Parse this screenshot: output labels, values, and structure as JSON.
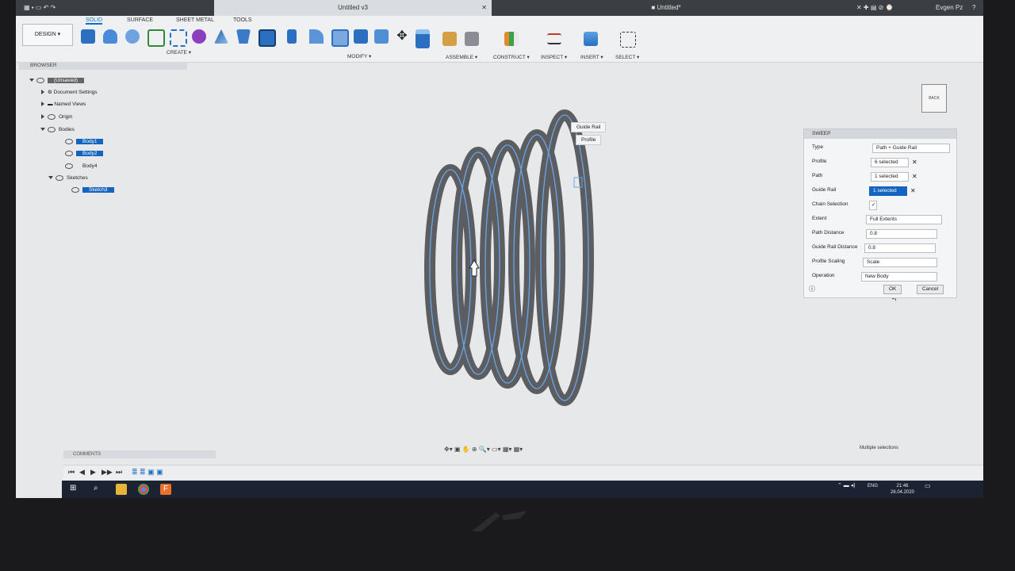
{
  "window": {
    "tab_left": "Untitled v3",
    "tab_right": "Untitled*",
    "user": "Evgen Pz"
  },
  "ribbon": {
    "tabs": [
      "SOLID",
      "SURFACE",
      "SHEET METAL",
      "TOOLS"
    ],
    "design_label": "DESIGN ▾",
    "groups": [
      "CREATE ▾",
      "MODIFY ▾",
      "ASSEMBLE ▾",
      "CONSTRUCT ▾",
      "INSPECT ▾",
      "INSERT ▾",
      "SELECT ▾"
    ]
  },
  "browser": {
    "title": "BROWSER",
    "root": "(Unsaved)",
    "items": [
      "Document Settings",
      "Named Views",
      "Origin",
      "Bodies",
      "Body1",
      "Body2",
      "Body4",
      "Sketches",
      "Sketch3"
    ]
  },
  "context_menu": {
    "item1": "Guide Rail",
    "item2": "Profile"
  },
  "viewcube": {
    "label": "BACK"
  },
  "sweep": {
    "title": "SWEEP",
    "type_label": "Type",
    "type_value": "Path + Guide Rail",
    "profile_label": "Profile",
    "profile_value": "6 selected",
    "path_label": "Path",
    "path_value": "1 selected",
    "guide_rail_label": "Guide Rail",
    "guide_rail_value": "1 selected",
    "chain_label": "Chain Selection",
    "extent_label": "Extent",
    "extent_value": "Full Extents",
    "path_distance_label": "Path Distance",
    "path_distance_value": "0.8",
    "guide_rail_distance_label": "Guide Rail Distance",
    "guide_rail_distance_value": "0.8",
    "profile_scaling_label": "Profile Scaling",
    "profile_scaling_value": "Scale",
    "operation_label": "Operation",
    "operation_value": "New Body",
    "ok": "OK",
    "cancel": "Cancel"
  },
  "comments_label": "COMMENTS",
  "status_message": "Multiple selections",
  "taskbar": {
    "lang": "ENG",
    "time": "21:46",
    "date": "26.04.2020"
  }
}
